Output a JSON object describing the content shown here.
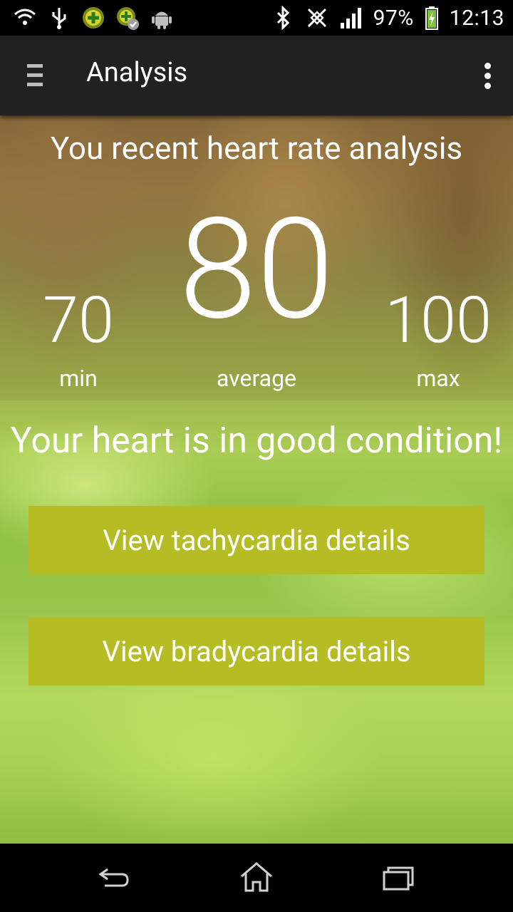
{
  "status_bar": {
    "icons_left": [
      "wifi-question-icon",
      "usb-icon",
      "game-plus-icon",
      "game-check-icon",
      "android-icon"
    ],
    "icons_right": [
      "bluetooth-icon",
      "nfc-icon",
      "signal-icon",
      "battery-charging-icon"
    ],
    "battery": "97%",
    "time": "12:13"
  },
  "action_bar": {
    "title": "Analysis"
  },
  "analysis": {
    "headline": "You recent heart rate analysis",
    "min": {
      "value": "70",
      "label": "min"
    },
    "average": {
      "value": "80",
      "label": "average"
    },
    "max": {
      "value": "100",
      "label": "max"
    },
    "condition": "Your heart is in good condition!"
  },
  "buttons": {
    "tachycardia": "View tachycardia details",
    "bradycardia": "View bradycardia details"
  },
  "colors": {
    "button": "#b6bd24",
    "action_bar": "#212121"
  },
  "nav_bar": {
    "icons": [
      "back-icon",
      "home-icon",
      "recent-apps-icon"
    ]
  }
}
